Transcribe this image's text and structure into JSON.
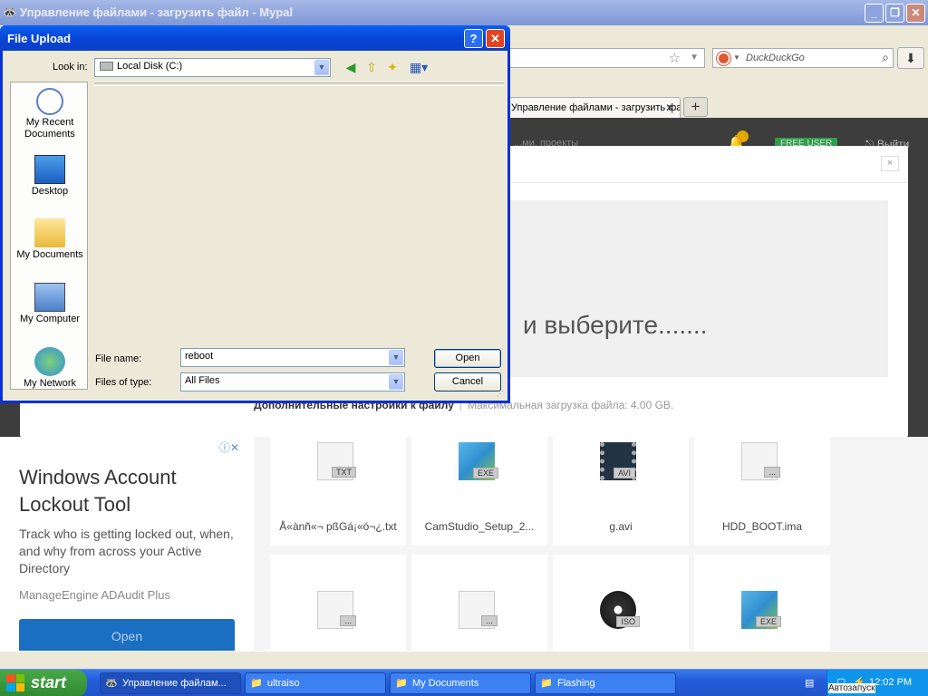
{
  "browser": {
    "title": "Управление файлами - загрузить файл - Mypal",
    "search_placeholder": "DuckDuckGo",
    "tab_title": "Управление файлами - загрузить файл"
  },
  "site": {
    "nav_text": "...ми, проекты",
    "free_user": "FREE USER",
    "exit": "Выйти",
    "close": "×",
    "drop_text": "и выберите.......",
    "advanced": "Дополнительные настройки к файлу",
    "max_upload": "Максимальная загрузка файла: 4.00 GB.",
    "files": [
      {
        "name": "Å«ànñ«¬ pßGá¡«ó¬¿.txt",
        "ext": "TXT"
      },
      {
        "name": "CamStudio_Setup_2...",
        "ext": "EXE"
      },
      {
        "name": "g.avi",
        "ext": "AVI"
      },
      {
        "name": "HDD_BOOT.ima",
        "ext": "..."
      },
      {
        "name": "",
        "ext": "..."
      },
      {
        "name": "",
        "ext": "..."
      },
      {
        "name": "",
        "ext": "ISO"
      },
      {
        "name": "",
        "ext": "EXE"
      }
    ]
  },
  "ad": {
    "headline": "Windows Account Lockout Tool",
    "body": "Track who is getting locked out, when, and why from across your Active Directory",
    "source": "ManageEngine ADAudit Plus",
    "button": "Open"
  },
  "dialog": {
    "title": "File Upload",
    "look_in_label": "Look in:",
    "look_in_value": "Local Disk (C:)",
    "places": [
      "My Recent Documents",
      "Desktop",
      "My Documents",
      "My Computer",
      "My Network"
    ],
    "file_name_label": "File name:",
    "file_name_value": "reboot",
    "files_of_type_label": "Files of type:",
    "files_of_type_value": "All Files",
    "open": "Open",
    "cancel": "Cancel"
  },
  "taskbar": {
    "start": "start",
    "items": [
      "Управление файлам...",
      "ultraiso",
      "My Documents",
      "Flashing"
    ],
    "clock": "12:02 PM",
    "tooltip": "Автозапуск"
  }
}
